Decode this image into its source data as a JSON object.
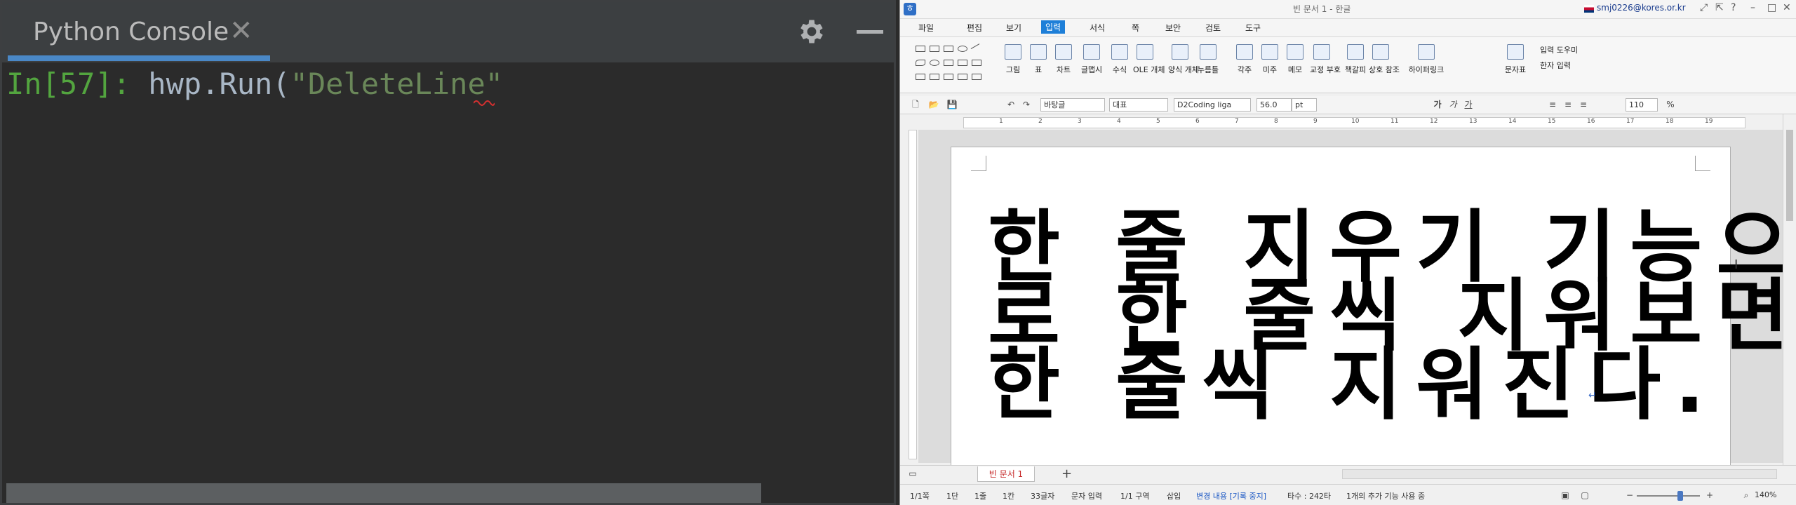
{
  "console": {
    "tab_title": "Python Console",
    "close_glyph": "✕",
    "prompt": "In[57]: ",
    "code_prefix": "hwp.Run(",
    "code_string": "\"DeleteLine\""
  },
  "hwp": {
    "window_title": "빈 문서 1 - 한글",
    "user_email": "smj0226@kores.or.kr",
    "menu": [
      "파일",
      "편집",
      "보기",
      "입력",
      "서식",
      "쪽",
      "보안",
      "검토",
      "도구"
    ],
    "active_menu": "입력",
    "ribbon": [
      "그림",
      "표",
      "차트",
      "글맵시",
      "수식",
      "OLE 개체",
      "양식 개체",
      "누름틀",
      "각주",
      "미주",
      "메모",
      "교정 부호",
      "책갈피",
      "상호 참조",
      "하이퍼링크",
      "문자표"
    ],
    "ribbon_right": [
      "입력 도우미",
      "한자 입력"
    ],
    "format": {
      "style": "바탕글",
      "lang": "대표",
      "font": "D2Coding liga",
      "size": "56.0",
      "unit": "pt",
      "line_spacing": "110",
      "percent": "%"
    },
    "ruler_numbers": [
      "1",
      "2",
      "3",
      "4",
      "5",
      "6",
      "7",
      "8",
      "9",
      "10",
      "11",
      "12",
      "13",
      "14",
      "15",
      "16",
      "17",
      "18",
      "19"
    ],
    "document_lines": [
      "한 줄 지우기 기능으",
      "로 한 줄씩 지워보면",
      "한 줄씩 지워진다."
    ],
    "para_mark": "↵",
    "doc_tab": "빈 문서 1",
    "status": {
      "page": "1/1쪽",
      "section1": "1단",
      "line": "1줄",
      "col": "1칸",
      "chars": "33글자",
      "mode": "문자 입력",
      "region": "1/1 구역",
      "insert": "삽입",
      "track": "변경 내용 [기록 중지]",
      "typing": "타수 : 242타",
      "addons": "1개의 추가 기능 사용 중",
      "zoom": "140%"
    }
  }
}
